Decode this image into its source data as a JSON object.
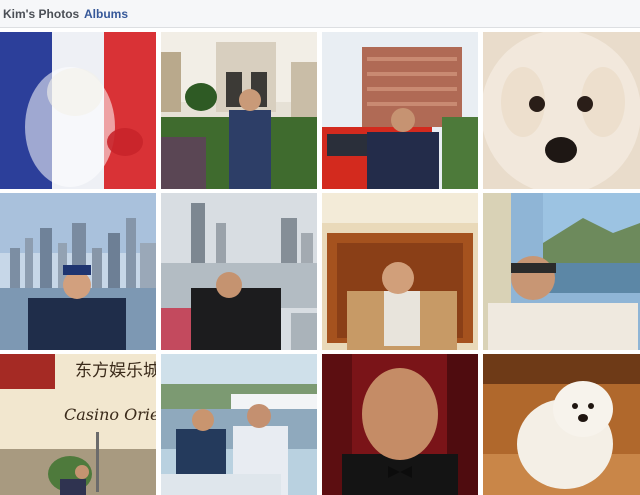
{
  "tabs": {
    "kims_photos": "Kim's Photos",
    "albums": "Albums"
  },
  "photo_grid": {
    "overlay_texts": {
      "casino_chinese": "东方娱乐城",
      "casino_english": "Casino Oriental"
    }
  },
  "colors": {
    "tab_bar_bg": "#f6f7f9",
    "tab_link": "#365899",
    "tab_active": "#4b4f56"
  }
}
